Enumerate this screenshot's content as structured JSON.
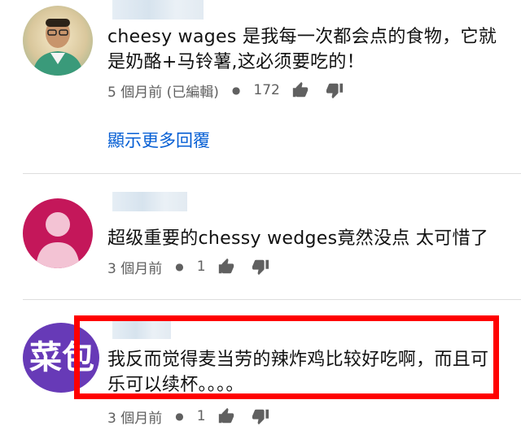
{
  "comments": [
    {
      "text": "cheesy wages 是我每一次都会点的食物，它就是奶酪+马铃薯,这必须要吃的！",
      "time": "5 個月前 (已編輯)",
      "likes": "172",
      "replies_label": "顯示更多回覆"
    },
    {
      "text": "超级重要的chessy wedges竟然没点 太可惜了",
      "time": "3 個月前",
      "likes": "1"
    },
    {
      "avatar_text": "菜包",
      "text": "我反而觉得麦当劳的辣炸鸡比较好吃啊，而且可乐可以续杯。。。。",
      "time": "3 個月前",
      "likes": "1"
    }
  ],
  "colors": {
    "highlight": "#ff0000",
    "link": "#065fd4",
    "meta": "#606060"
  },
  "icons": [
    "thumb-up-icon",
    "thumb-down-icon"
  ]
}
